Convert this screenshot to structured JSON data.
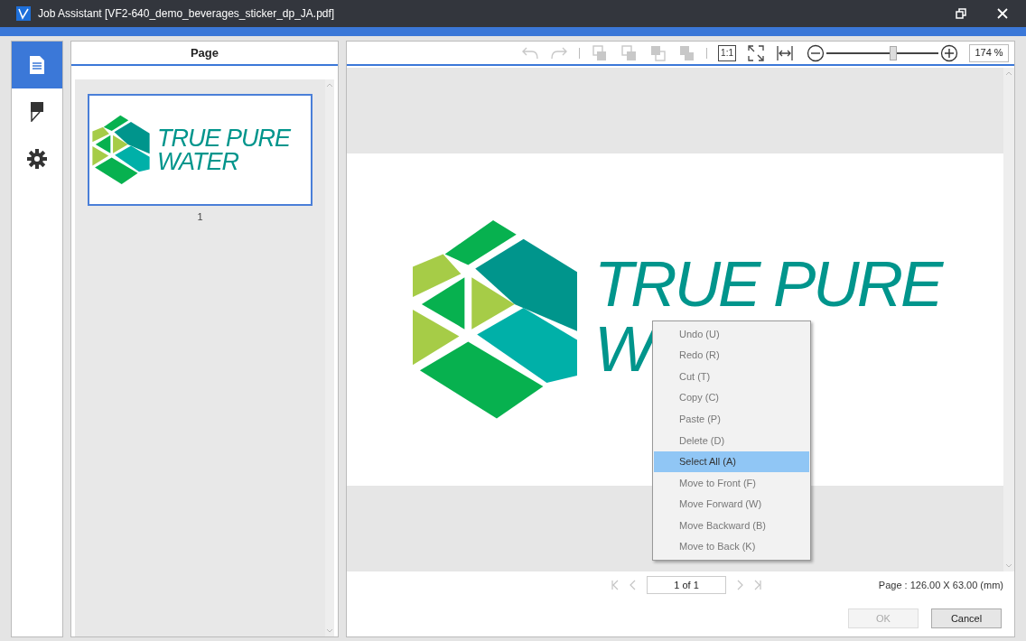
{
  "window": {
    "title": "Job Assistant [VF2-640_demo_beverages_sticker_dp_JA.pdf]"
  },
  "sidebar": {
    "items": [
      {
        "kind": "page",
        "selected": true
      },
      {
        "kind": "marker",
        "selected": false
      },
      {
        "kind": "settings",
        "selected": false
      }
    ]
  },
  "page_panel": {
    "title": "Page",
    "thumbnails": [
      {
        "logo_lines": [
          "TRUE PURE",
          "WATER"
        ],
        "label": "1",
        "selected": true
      }
    ]
  },
  "toolbar": {
    "tools": [
      {
        "kind": "undo",
        "disabled": true
      },
      {
        "kind": "redo",
        "disabled": true
      },
      {
        "kind": "separator"
      },
      {
        "kind": "to-front",
        "disabled": true
      },
      {
        "kind": "forward",
        "disabled": true
      },
      {
        "kind": "backward",
        "disabled": true
      },
      {
        "kind": "to-back",
        "disabled": true
      },
      {
        "kind": "separator"
      },
      {
        "kind": "actual-size",
        "label": "1:1",
        "disabled": false
      },
      {
        "kind": "fit",
        "disabled": false
      },
      {
        "kind": "fit-width",
        "disabled": false
      }
    ],
    "zoom": {
      "level": 0.6,
      "reading": "174 %"
    }
  },
  "canvas": {
    "logo_lines": [
      "TRUE PURE",
      "W"
    ]
  },
  "context_menu": {
    "items": [
      {
        "label": "Undo (U)",
        "selected": false
      },
      {
        "label": "Redo (R)",
        "selected": false
      },
      {
        "label": "Cut (T)",
        "selected": false
      },
      {
        "label": "Copy (C)",
        "selected": false
      },
      {
        "label": "Paste (P)",
        "selected": false
      },
      {
        "label": "Delete (D)",
        "selected": false
      },
      {
        "label": "Select All (A)",
        "selected": true
      },
      {
        "label": "Move to Front (F)",
        "selected": false
      },
      {
        "label": "Move Forward (W)",
        "selected": false
      },
      {
        "label": "Move Backward (B)",
        "selected": false
      },
      {
        "label": "Move to Back (K)",
        "selected": false
      }
    ]
  },
  "pager": {
    "value": "1 of 1",
    "disabled": true
  },
  "page_size": "Page : 126.00 X 63.00 (mm)",
  "buttons": [
    {
      "label": "OK",
      "disabled": true
    },
    {
      "label": "Cancel",
      "disabled": false
    }
  ]
}
